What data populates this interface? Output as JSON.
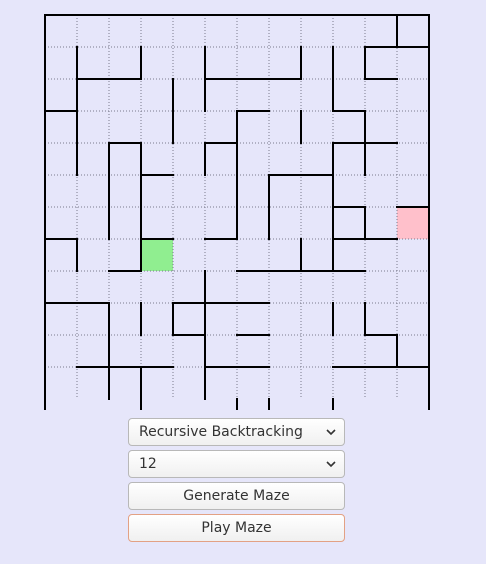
{
  "maze": {
    "rows": 12,
    "cols": 12,
    "start": [
      7,
      3
    ],
    "goal": [
      6,
      11
    ],
    "colors": {
      "background": "#e6e6fa",
      "wall": "#000000",
      "grid": "#7a7a8c",
      "start": "#90ee90",
      "goal": "#ffc0cb"
    },
    "h_walls": [
      "111111111111",
      "000000000011",
      "011001110010",
      "100000100100",
      "001001000110",
      "000100011000",
      "000000000101",
      "100101000110",
      "001000111100",
      "110011100000",
      "000010100010",
      "011101100111",
      "000000000000",
      "111111111111"
    ],
    "v_walls": [
      "1000000000011",
      "1101010011101",
      "1100110001001",
      "1100101010101",
      "1111011001101",
      "1011001101001",
      "1011001101101",
      "1101000011001",
      "1000010000001",
      "1011110001101",
      "1010010000011",
      "1011010000001",
      "1001001101001",
      "1100010000001"
    ]
  },
  "controls": {
    "algorithm": {
      "value": "Recursive Backtracking"
    },
    "size": {
      "value": "12"
    },
    "generate_label": "Generate Maze",
    "play_label": "Play Maze"
  }
}
